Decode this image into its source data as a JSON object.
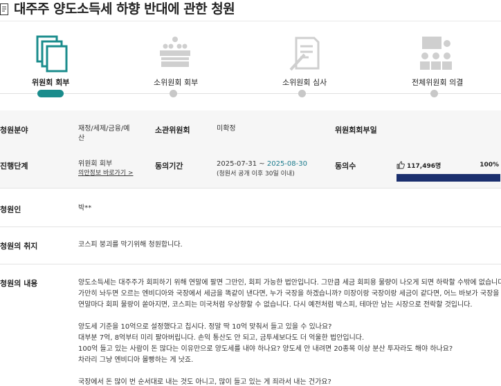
{
  "page": {
    "title": "대주주 양도소득세 하향 반대에 관한 청원"
  },
  "steps": [
    {
      "label": "위원회 회부",
      "icon": "documents-icon",
      "active": true
    },
    {
      "label": "소위원회 회부",
      "icon": "committee-meeting-icon",
      "active": false
    },
    {
      "label": "소위원회 심사",
      "icon": "review-document-icon",
      "active": false
    },
    {
      "label": "전체위원회 의결",
      "icon": "presentation-icon",
      "active": false
    }
  ],
  "info": {
    "field_label": "청원분야",
    "field_value": "재정/세제/금융/예산",
    "field_value_line1": "재정/세제/금융/예",
    "field_value_line2": "산",
    "committee_label": "소관위원회",
    "committee_value": "미확정",
    "referral_label": "위원회회부일",
    "referral_value": "",
    "stage_label": "진행단계",
    "stage_value": "위원회 회부",
    "stage_link": "의안정보 바로가기 >",
    "period_label": "동의기간",
    "period_start": "2025-07-31 ~ ",
    "period_end": "2025-08-30",
    "period_note": "(청원서 공개 이후 30일 이내)",
    "agree_label": "동의수",
    "agree_count": "117,496명",
    "agree_percent": "100%",
    "agree_fraction": 1.0,
    "petitioner_label": "청원인",
    "petitioner_value": "박**",
    "purpose_label": "청원의 취지",
    "purpose_value": "코스피 붕괴를 막기위해 청원합니다.",
    "content_label": "청원의 내용"
  },
  "content_lines": [
    "양도소득세는 대주주가 회피하기 위해 연말에 팔면 그만인, 회피 가능한 법안입니다. 그만큼 세금 회피용 물량이 나오게 되면 하락할 수밖에 없습니다.",
    "가만히 놔두면 오르는 엔비디아와 국장에서 세금을 똑같이 낸다면, 누가 국장을 하겠습니까? 미장이랑 국장이랑 세금이 같다면, 어느 바보가 국장을 합니까?",
    "연말마다 회피 물량이 쏟아지면, 코스피는 미국처럼 우상향할 수 없습니다. 다시 예전처럼 박스피, 테마만 남는 시장으로 전락할 것입니다.",
    "",
    "양도세 기준을 10억으로 설정했다고 칩시다. 정말 딱 10억 맞춰서 들고 있을 수 있나요?",
    "대부분 7억, 8억부터 미리 팔아버립니다. 손익 통산도 안 되고, 금투세보다도 더 억울한 법안입니다.",
    "100억 들고 있는 사람이 돈 많다는 이유만으로 양도세를 내야 하나요? 양도세 안 내려면 20종목 이상 분산 투자라도 해야 하나요?",
    "차라리 그냥 엔비디아 몰빵하는 게 낫죠.",
    "",
    "국장에서 돈 많이 번 순서대로 내는 것도 아니고, 많이 들고 있는 게 죄라서 내는 건가요?"
  ],
  "colors": {
    "accent": "#1a8c8c",
    "bar": "#1b2f6e",
    "date_end": "#1a7a8c"
  }
}
